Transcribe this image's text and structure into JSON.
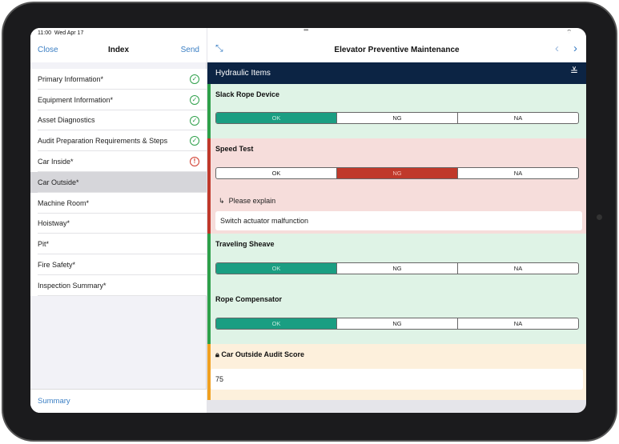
{
  "status": {
    "time": "11:00",
    "date": "Wed Apr 17"
  },
  "sidebar": {
    "close": "Close",
    "title": "Index",
    "send": "Send",
    "footer": "Summary",
    "items": [
      {
        "label": "Primary Information*",
        "state": "complete"
      },
      {
        "label": "Equipment Information*",
        "state": "complete"
      },
      {
        "label": "Asset Diagnostics",
        "state": "complete"
      },
      {
        "label": "Audit Preparation Requirements & Steps",
        "state": "complete"
      },
      {
        "label": "Car Inside*",
        "state": "warning"
      },
      {
        "label": "Car Outside*",
        "state": "selected"
      },
      {
        "label": "Machine Room*"
      },
      {
        "label": "Hoistway*"
      },
      {
        "label": "Pit*"
      },
      {
        "label": "Fire Safety*"
      },
      {
        "label": "Inspection Summary*"
      }
    ]
  },
  "main": {
    "title": "Elevator Preventive Maintenance",
    "section": "Hydraulic Items",
    "options": [
      "OK",
      "NG",
      "NA"
    ],
    "items": [
      {
        "title": "Slack Rope Device",
        "selected": "OK"
      },
      {
        "title": "Speed Test",
        "selected": "NG",
        "explain_label": "Please explain",
        "explain_value": "Switch actuator malfunction"
      },
      {
        "title": "Traveling Sheave",
        "selected": "OK"
      },
      {
        "title": "Rope Compensator",
        "selected": "OK"
      }
    ],
    "score": {
      "title": "Car Outside Audit Score",
      "value": "75"
    }
  },
  "colors": {
    "ok": "#1a9e82",
    "ng": "#c0392b",
    "navy": "#0c2444",
    "link": "#3b7fc4"
  }
}
